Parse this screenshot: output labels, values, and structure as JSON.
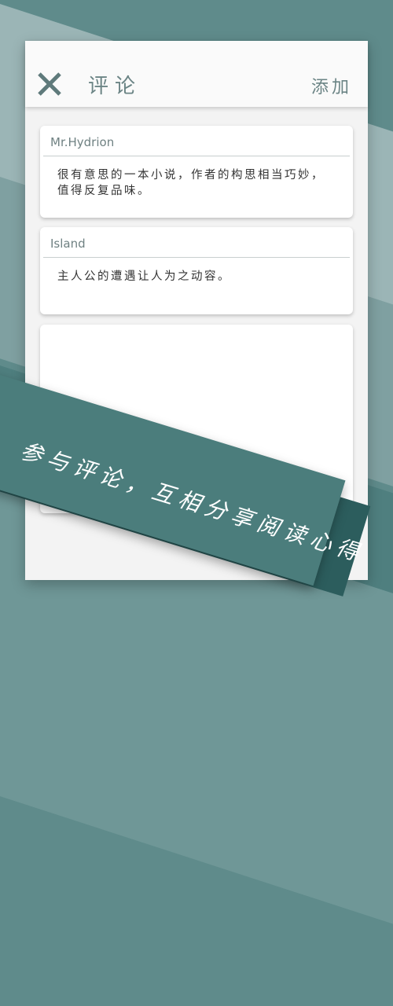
{
  "header": {
    "title": "评论",
    "add_label": "添加",
    "close_icon": "close-icon"
  },
  "comments": [
    {
      "user": "Mr.Hydrion",
      "text": "很有意思的一本小说，作者的构思相当巧妙，值得反复品味。"
    },
    {
      "user": "Island",
      "text": "主人公的遭遇让人为之动容。"
    }
  ],
  "banner": {
    "text": "参与评论，互相分享阅读心得"
  },
  "colors": {
    "accent": "#4b7d7c",
    "header_text": "#6b8485",
    "card_bg": "#ffffff",
    "page_bg": "#f3f3f3"
  }
}
